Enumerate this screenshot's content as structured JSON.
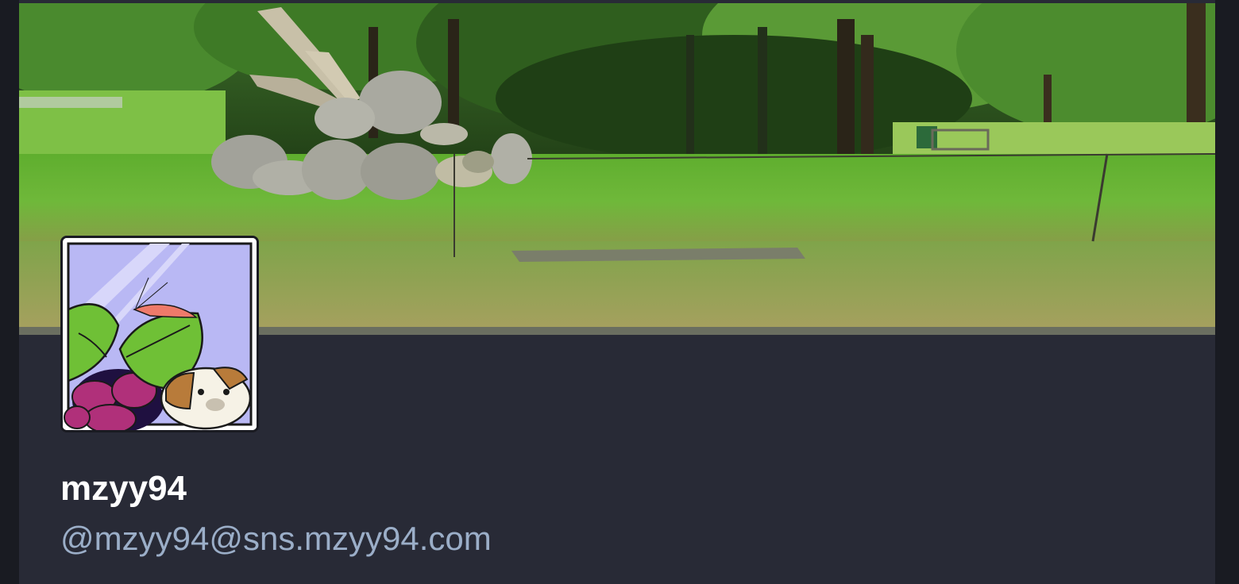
{
  "profile": {
    "display_name": "mzyy94",
    "handle": "@mzyy94@sns.mzyy94.com"
  },
  "header_image": {
    "subject": "forest-clearing-with-rocks-and-grass"
  },
  "avatar_image": {
    "subject": "raspberry-logo-with-shrimp-and-dog-illustration"
  },
  "colors": {
    "page_background": "#191b22",
    "card_background": "#282a36",
    "display_name": "#ffffff",
    "handle": "#9baec8"
  }
}
